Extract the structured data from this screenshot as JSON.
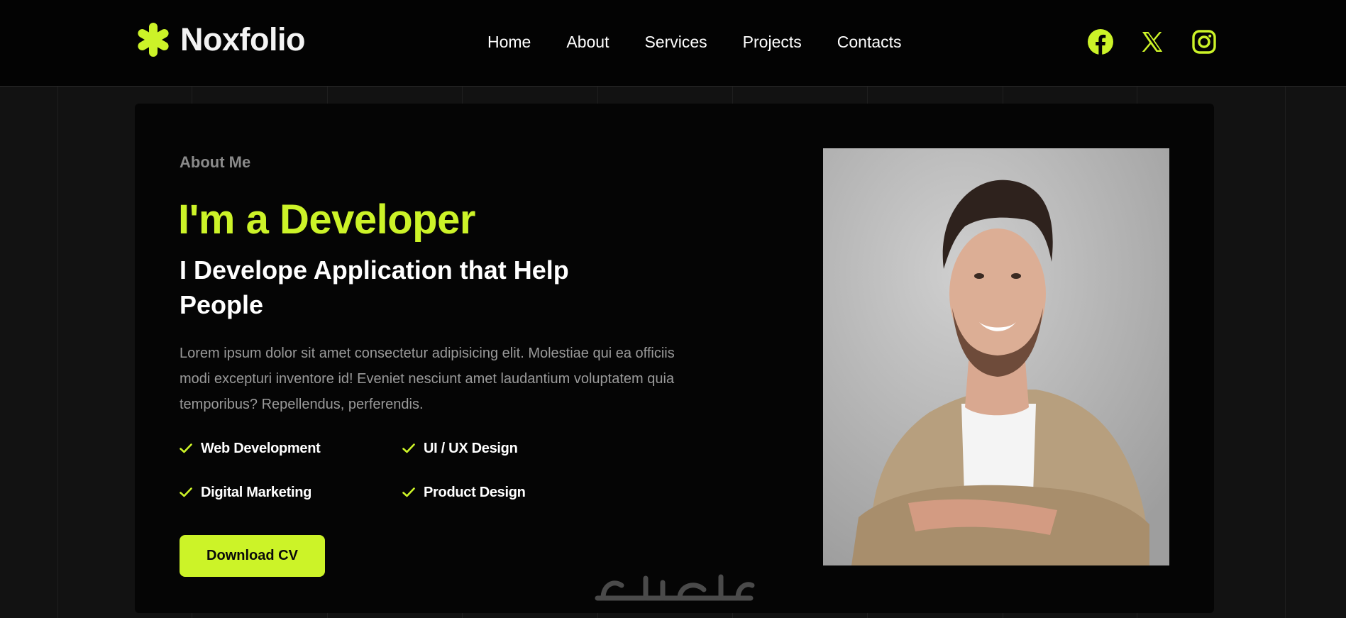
{
  "brand": {
    "name": "Noxfolio",
    "logo_icon": "asterisk-logo-icon"
  },
  "nav": {
    "items": [
      {
        "label": "Home"
      },
      {
        "label": "About"
      },
      {
        "label": "Services"
      },
      {
        "label": "Projects"
      },
      {
        "label": "Contacts"
      }
    ]
  },
  "socials": [
    {
      "icon": "facebook-icon"
    },
    {
      "icon": "x-twitter-icon"
    },
    {
      "icon": "instagram-icon"
    }
  ],
  "about": {
    "label": "About Me",
    "headline": "I'm a Developer",
    "subheadline": "I Develope Application that Help People",
    "description": "Lorem ipsum dolor sit amet consectetur adipisicing elit. Molestiae qui ea officiis modi excepturi inventore id! Eveniet nesciunt amet laudantium voluptatem quia temporibus? Repellendus, perferendis.",
    "skills": [
      {
        "label": "Web Development"
      },
      {
        "label": "UI / UX Design"
      },
      {
        "label": "Digital Marketing"
      },
      {
        "label": "Product Design"
      }
    ],
    "cta_label": "Download CV",
    "photo_icon": "portrait-photo"
  },
  "colors": {
    "accent": "#ccf328",
    "header_bg": "#030303",
    "page_bg": "#121212",
    "card_bg": "#050505",
    "muted_text": "#9a9a9a"
  }
}
